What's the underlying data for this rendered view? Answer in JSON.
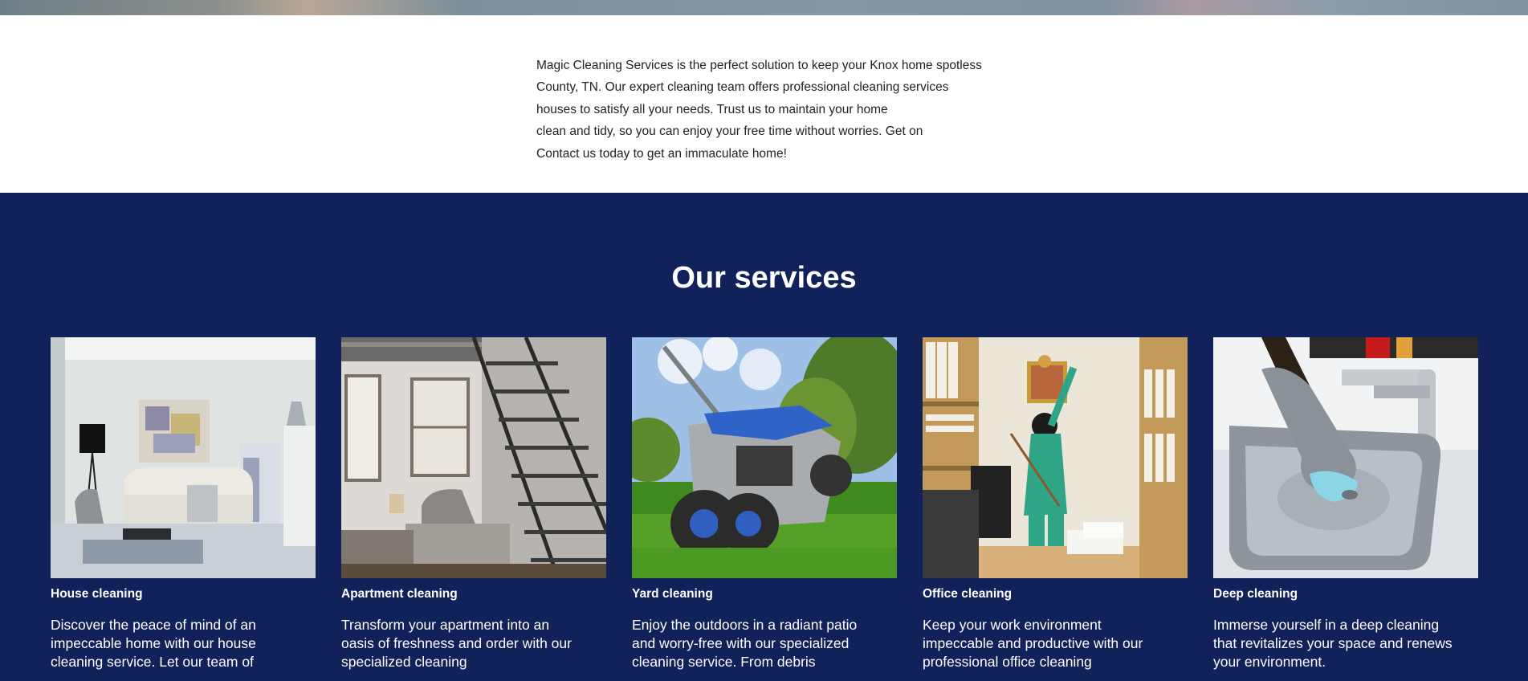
{
  "intro": {
    "lines": [
      "Magic Cleaning Services is the perfect solution to keep your Knox home spotless",
      "County, TN. Our expert cleaning team offers professional cleaning services",
      "houses to satisfy all your needs. Trust us to maintain your home",
      "clean and tidy, so you can enjoy your free time without worries. Get on",
      "Contact us today to get an immaculate home!"
    ]
  },
  "services": {
    "title": "Our services",
    "cards": [
      {
        "title": "House cleaning",
        "desc": "Discover the peace of mind of an impeccable home with our house cleaning service. Let our team of"
      },
      {
        "title": "Apartment cleaning",
        "desc": "Transform your apartment into an oasis of freshness and order with our specialized cleaning"
      },
      {
        "title": "Yard cleaning",
        "desc": "Enjoy the outdoors in a radiant patio and worry-free with our specialized cleaning service. From debris"
      },
      {
        "title": "Office cleaning",
        "desc": "Keep your work environment impeccable and productive with our professional office cleaning"
      },
      {
        "title": "Deep cleaning",
        "desc": "Immerse yourself in a deep cleaning that revitalizes your space and renews your environment."
      }
    ]
  },
  "colors": {
    "services_bg": "#11215a",
    "intro_bg": "#ffffff"
  }
}
